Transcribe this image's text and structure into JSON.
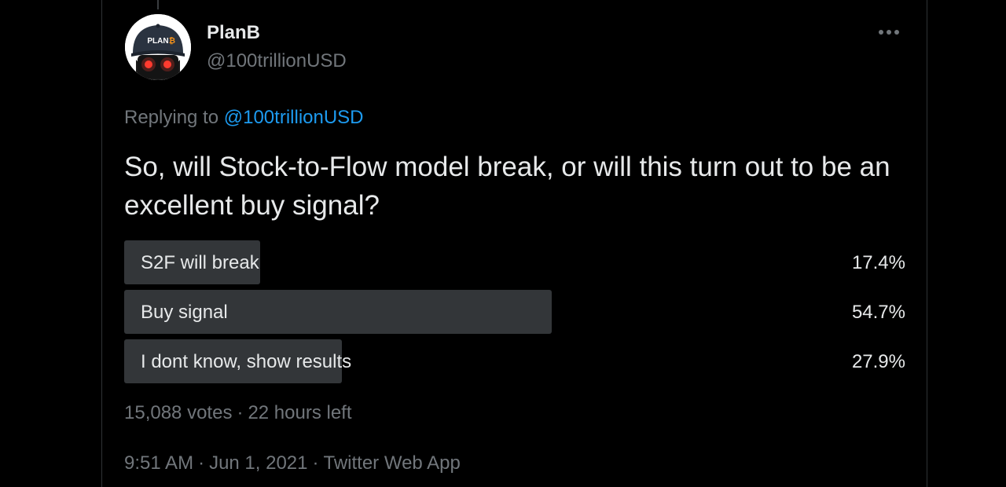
{
  "author": {
    "display_name": "PlanB",
    "handle": "@100trillionUSD",
    "avatar_text": "PLAN B",
    "avatar_icon": "cap-with-red-eyes-avatar"
  },
  "reply": {
    "prefix": "Replying to",
    "mention": "@100trillionUSD"
  },
  "tweet_text": "So, will Stock-to-Flow model break, or will this turn out to be an excellent buy signal?",
  "poll": {
    "options": [
      {
        "label": "S2F will break",
        "percent_text": "17.4%",
        "fraction": 0.174
      },
      {
        "label": "Buy signal",
        "percent_text": "54.7%",
        "fraction": 0.547
      },
      {
        "label": "I dont know, show results",
        "percent_text": "27.9%",
        "fraction": 0.279
      }
    ],
    "votes": "15,088 votes",
    "separator": "·",
    "time_left": "22 hours left"
  },
  "meta": {
    "time": "9:51 AM",
    "date": "Jun 1, 2021",
    "source": "Twitter Web App",
    "separator": "·"
  },
  "colors": {
    "background": "#000000",
    "text": "#e7e9ea",
    "muted": "#71767b",
    "link": "#1d9bf0",
    "poll_bar": "#333639"
  },
  "icons": {
    "more": "more-horizontal-icon"
  }
}
